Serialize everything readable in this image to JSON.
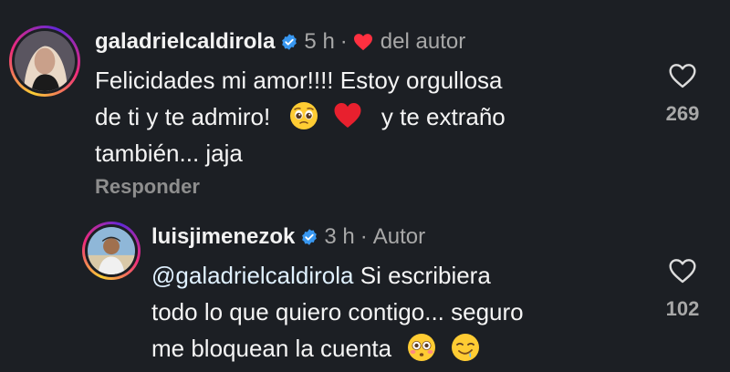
{
  "comment": {
    "username": "galadrielcaldirola",
    "verified_icon": "verified-badge-icon",
    "time": "5 h",
    "separator": "·",
    "liked_by_author_label": "del autor",
    "text_line1": "Felicidades mi amor!!!! Estoy orgullosa",
    "text_line2_a": "de ti y te admiro!",
    "text_line2_b": "y te extraño",
    "text_line3": "también... jaja",
    "reply_label": "Responder",
    "like_count": "269",
    "colors": {
      "author_heart": "#ff3040",
      "verified": "#3897f0"
    }
  },
  "reply": {
    "username": "luisjimenezok",
    "time": "3 h",
    "separator": "·",
    "author_label": "Autor",
    "mention": "@galadrielcaldirola",
    "text_line1_rest": "Si escribiera",
    "text_line2": "todo lo que quiero contigo... seguro",
    "text_line3": "me bloquean la cuenta",
    "like_count": "102"
  }
}
